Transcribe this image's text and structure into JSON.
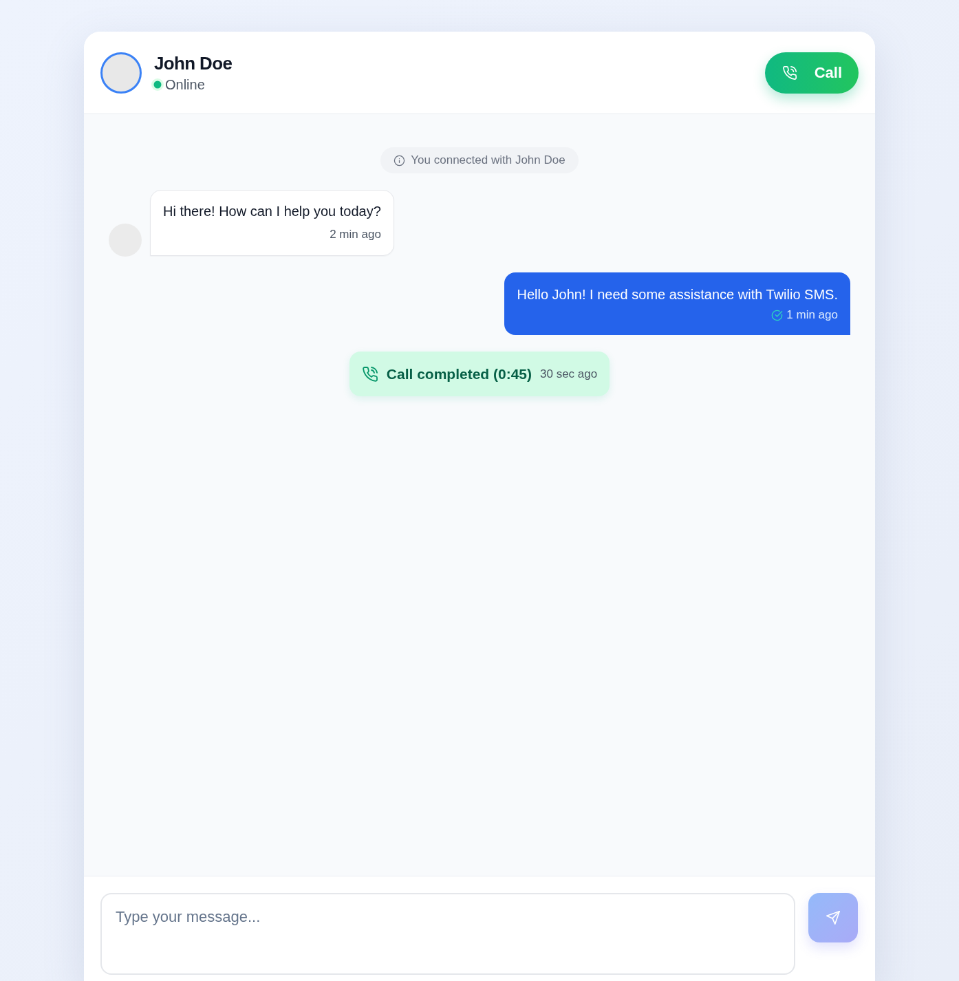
{
  "contact": {
    "name": "John Doe",
    "status": "Online",
    "online": true
  },
  "call_button": {
    "label": "Call"
  },
  "messages": [
    {
      "kind": "system",
      "text": "You connected with John Doe"
    },
    {
      "kind": "incoming",
      "text": "Hi there! How can I help you today?",
      "time": "2 min ago"
    },
    {
      "kind": "outgoing",
      "text": "Hello John! I need some assistance with Twilio SMS.",
      "time": "1 min ago",
      "delivered": true
    },
    {
      "kind": "call",
      "text": "Call completed (0:45)",
      "time": "30 sec ago"
    }
  ],
  "composer": {
    "placeholder": "Type your message..."
  },
  "send_button": {
    "disabled": true
  }
}
